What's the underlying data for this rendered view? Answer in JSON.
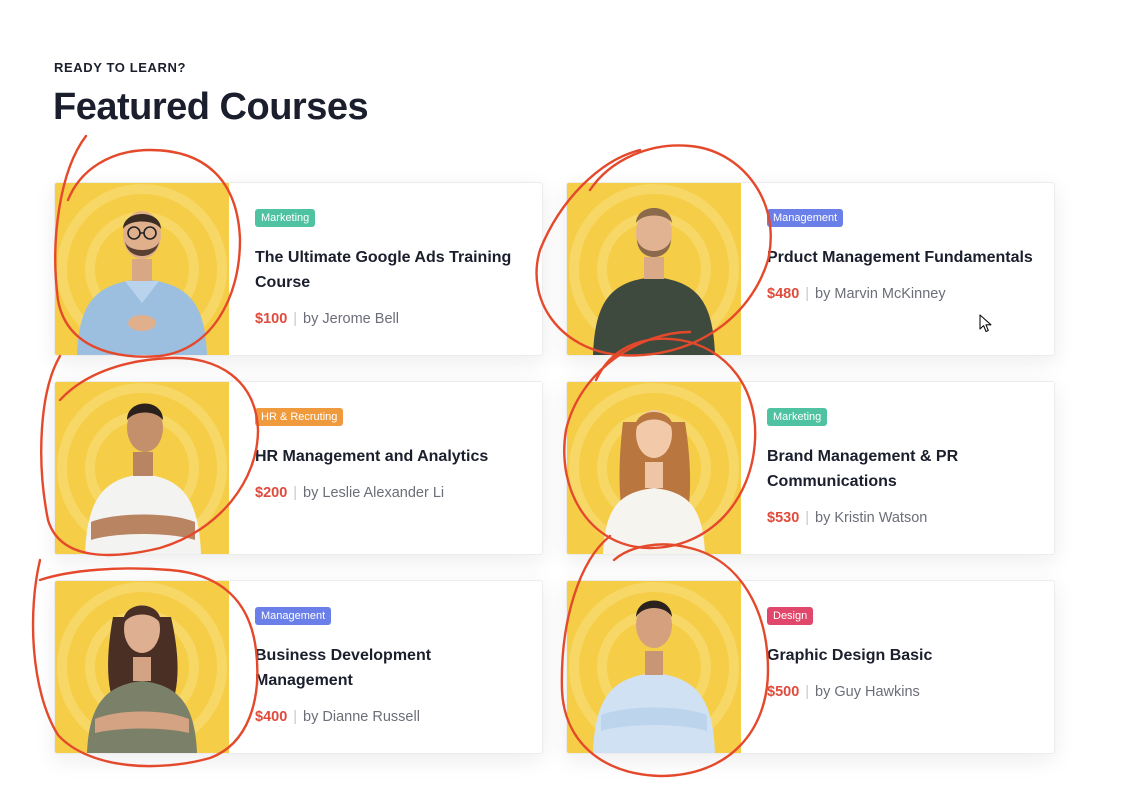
{
  "header": {
    "eyebrow": "READY TO LEARN?",
    "title": "Featured Courses"
  },
  "colors": {
    "thumb_bg": "#f5cd47",
    "price": "#e04b3c",
    "tag_marketing": "#4fc3a1",
    "tag_management": "#6a7fe8",
    "tag_hr": "#ef9a3d",
    "tag_design": "#e0476a",
    "annotation": "#e5492c"
  },
  "courses": [
    {
      "tag": "Marketing",
      "title": "The Ultimate Google Ads Training Course",
      "price": "$100",
      "instructor": "by Jerome Bell",
      "image": "man-glasses-denim-shirt"
    },
    {
      "tag": "Management",
      "title": "Prduct Management Fundamentals",
      "price": "$480",
      "instructor": "by Marvin McKinney",
      "image": "man-beard-green-sweater"
    },
    {
      "tag": "HR & Recruting",
      "title": "HR  Management and Analytics",
      "price": "$200",
      "instructor": "by Leslie Alexander Li",
      "image": "man-white-polo-arms-crossed"
    },
    {
      "tag": "Marketing",
      "title": "Brand Management & PR Communications",
      "price": "$530",
      "instructor": "by Kristin Watson",
      "image": "woman-long-hair-white-top"
    },
    {
      "tag": "Management",
      "title": "Business Development Management",
      "price": "$400",
      "instructor": "by Dianne Russell",
      "image": "woman-dark-hair-grey-tshirt"
    },
    {
      "tag": "Design",
      "title": "Graphic Design Basic",
      "price": "$500",
      "instructor": "by Guy Hawkins",
      "image": "man-light-blue-shirt-arms-crossed"
    }
  ]
}
